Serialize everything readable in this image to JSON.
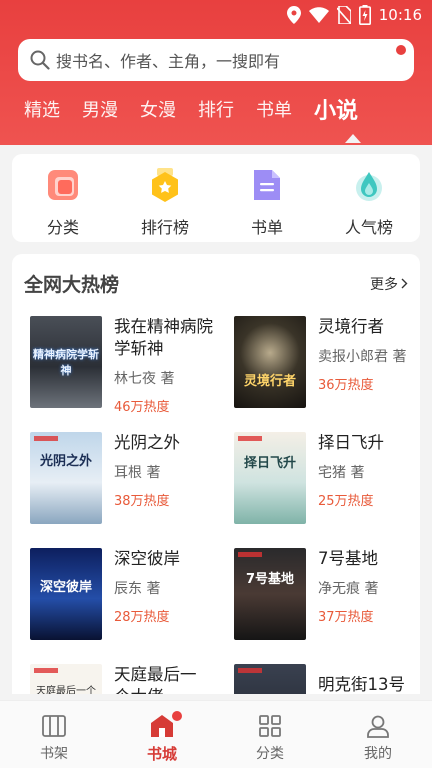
{
  "status": {
    "time": "10:16"
  },
  "search": {
    "placeholder": "搜书名、作者、主角，一搜即有"
  },
  "tabs": [
    "精选",
    "男漫",
    "女漫",
    "排行",
    "书单",
    "小说"
  ],
  "shortcuts": [
    {
      "label": "分类",
      "icon": "category-icon"
    },
    {
      "label": "排行榜",
      "icon": "ranking-icon"
    },
    {
      "label": "书单",
      "icon": "booklist-icon"
    },
    {
      "label": "人气榜",
      "icon": "popularity-icon"
    }
  ],
  "hot": {
    "title": "全网大热榜",
    "more": "更多",
    "books": [
      {
        "name": "我在精神病院学斩神",
        "author": "林七夜 著",
        "heat": "46万热度",
        "cover_title": "精神病院学斩神"
      },
      {
        "name": "灵境行者",
        "author": "卖报小郎君 著",
        "heat": "36万热度",
        "cover_title": "灵境行者"
      },
      {
        "name": "光阴之外",
        "author": "耳根 著",
        "heat": "38万热度",
        "cover_title": "光阴之外"
      },
      {
        "name": "择日飞升",
        "author": "宅猪 著",
        "heat": "25万热度",
        "cover_title": "择日飞升"
      },
      {
        "name": "深空彼岸",
        "author": "辰东 著",
        "heat": "28万热度",
        "cover_title": "深空彼岸"
      },
      {
        "name": "7号基地",
        "author": "净无痕 著",
        "heat": "37万热度",
        "cover_title": "7号基地"
      },
      {
        "name": "天庭最后一个大佬",
        "author": "",
        "heat": "",
        "cover_title": "天庭最后一个"
      },
      {
        "name": "明克街13号",
        "author": "",
        "heat": "",
        "cover_title": ""
      }
    ]
  },
  "nav": [
    {
      "label": "书架",
      "icon": "bookshelf-icon"
    },
    {
      "label": "书城",
      "icon": "bookstore-icon"
    },
    {
      "label": "分类",
      "icon": "grid-icon"
    },
    {
      "label": "我的",
      "icon": "profile-icon"
    }
  ],
  "colors": {
    "accent": "#e8403f",
    "heat": "#e85a3a"
  }
}
